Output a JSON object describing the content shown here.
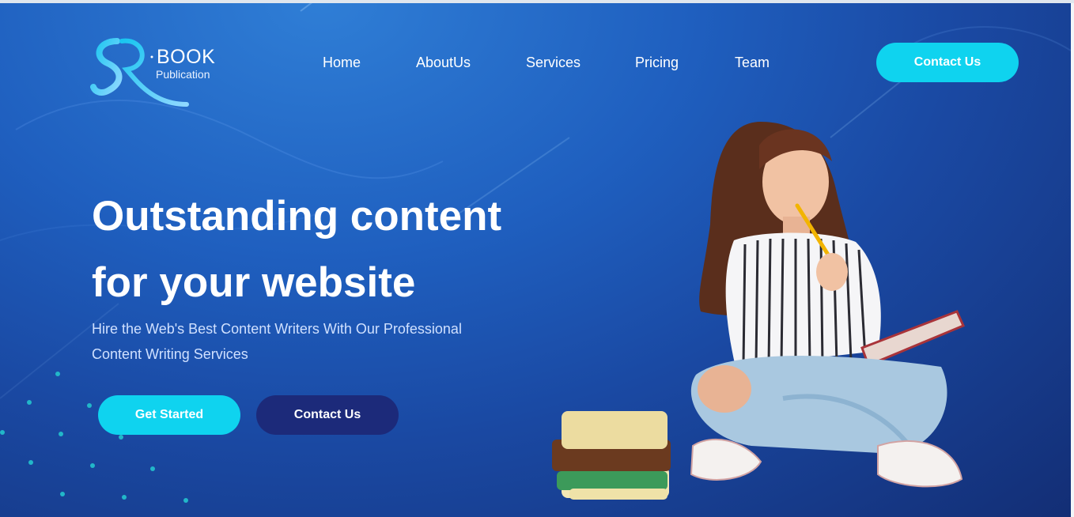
{
  "brand": {
    "monogram": "SR",
    "name": "BOOK",
    "tagline": "Publication"
  },
  "nav": {
    "items": [
      "Home",
      "AboutUs",
      "Services",
      "Pricing",
      "Team"
    ],
    "cta_label": "Contact Us"
  },
  "hero": {
    "headline_line1": "Outstanding content",
    "headline_line2": "for your website",
    "subtext_line1": "Hire the Web's Best Content Writers With Our Professional",
    "subtext_line2": "Content Writing Services",
    "primary_button": "Get Started",
    "secondary_button": "Contact Us"
  },
  "colors": {
    "accent_cyan": "#0fd3ef",
    "navy_button": "#1c2a7a",
    "hero_gradient_start": "#2f7ed6",
    "hero_gradient_end": "#132e75"
  },
  "illustration": {
    "icon": "woman-reading-with-books-illustration"
  }
}
